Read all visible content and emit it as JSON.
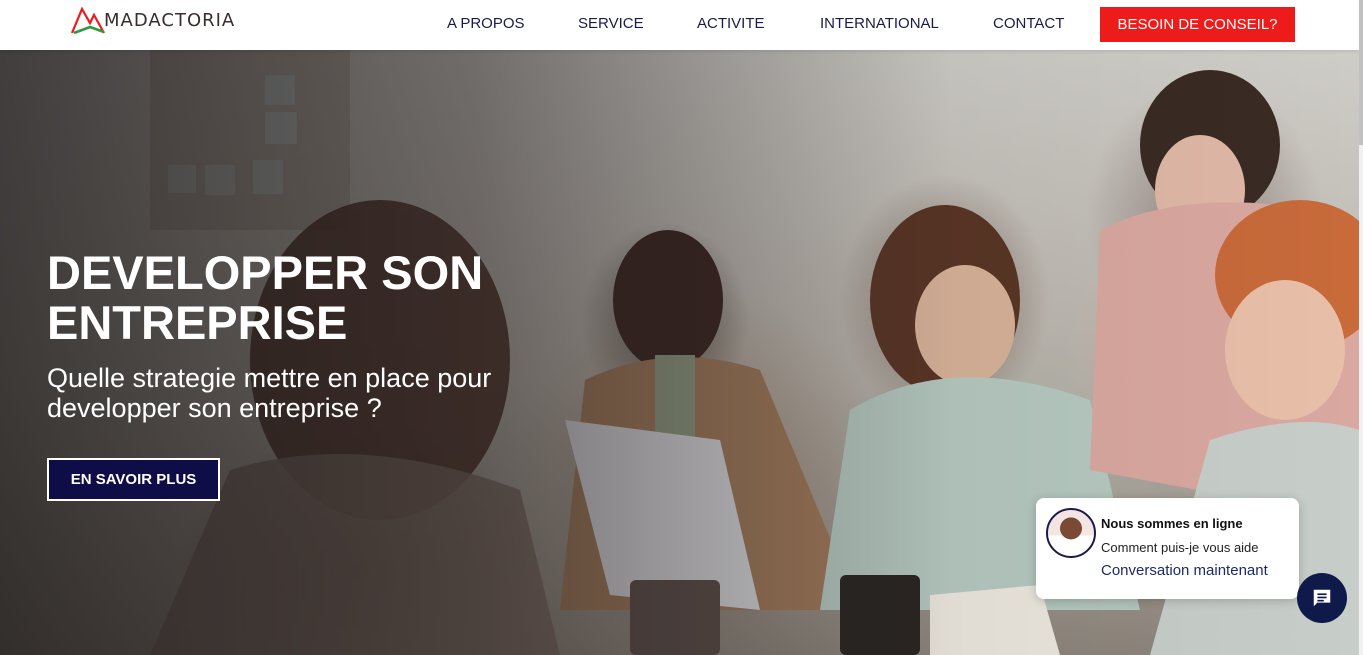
{
  "brand": {
    "logo_text": "MADACTORIA",
    "colors": {
      "red": "#ee1b1b",
      "green": "#2e9a3e",
      "navy": "#0f0d47"
    }
  },
  "nav": {
    "items": [
      {
        "label": "A PROPOS"
      },
      {
        "label": "SERVICE"
      },
      {
        "label": "ACTIVITE"
      },
      {
        "label": "INTERNATIONAL"
      },
      {
        "label": "CONTACT"
      }
    ],
    "cta_label": "BESOIN DE CONSEIL?"
  },
  "hero": {
    "title": "DEVELOPPER SON ENTREPRISE",
    "subtitle": "Quelle strategie mettre en place pour developper son entreprise ?",
    "button_label": "EN SAVOIR PLUS"
  },
  "chat": {
    "status": "Nous sommes en ligne",
    "prompt": "Comment puis-je vous aide",
    "link": "Conversation maintenant",
    "fab_icon": "chat-bubble-icon"
  }
}
